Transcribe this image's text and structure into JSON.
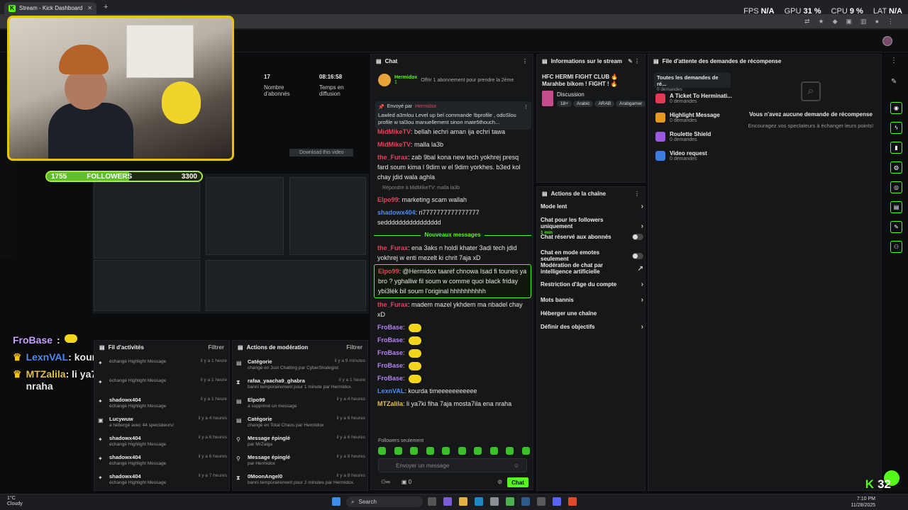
{
  "browser": {
    "tab_title": "Stream - Kick Dashboard",
    "new_tab": "+"
  },
  "perf": {
    "fps_label": "FPS",
    "fps": "N/A",
    "gpu_label": "GPU",
    "gpu": "31 %",
    "cpu_label": "CPU",
    "cpu": "9 %",
    "lat_label": "LAT",
    "lat": "N/A"
  },
  "stream_overlay": {
    "download_label": "Download this video",
    "followers_current": "1755",
    "followers_label": "FOLLOWERS",
    "followers_goal": "3300",
    "followers_progress": 0.53,
    "chat": [
      {
        "user": "FroBase",
        "text": ""
      },
      {
        "user": "LexnVAL",
        "text": "kourda timeeeeeeeeeee"
      },
      {
        "user": "MTZalila",
        "text": "li ya7ki fiha 7aja mosta7ila ena nraha"
      }
    ]
  },
  "stats": {
    "followers_value": "17",
    "followers_label": "Nombre d'abonnés",
    "time_value": "08:16:58",
    "time_label": "Temps en diffusion"
  },
  "chat": {
    "title": "Chat",
    "sub_user": "Hermidox",
    "sub_text": "Offrir 1 abonnement pour prendre la 2ème",
    "sub_count": "1",
    "pinned_label": "Envoyé par",
    "pinned_by": "Hermidox",
    "pinned_text": "Lawled a3mlou Level up bel commande !bprofile , odoSlou profile w tal3ou manuellement sinon mate5thouch...",
    "messages": [
      {
        "user": "MidMikeTV",
        "color": "#e0465a",
        "text": ": bellah iechri aman ija echri tawa"
      },
      {
        "user": "MidMikeTV",
        "color": "#e0465a",
        "text": ": malla la3b"
      },
      {
        "user": "the_Furax",
        "color": "#e0465a",
        "text": ": zab 9bal kona new tech yokhrej presq fard soum kima l 9dim w el 9dim yorkhes. b3ed kol chay jdid wala aghla"
      },
      {
        "reply": "Répondre à MidMikeTV: malla la3b"
      },
      {
        "user": "Elpo99",
        "color": "#e0465a",
        "text": ": marketing scam wallah"
      },
      {
        "user": "shadowx404",
        "color": "#4d8cf5",
        "text": ": ri7777777777777777 sedddddddddddddddd"
      },
      {
        "separator": "Nouveaux messages"
      },
      {
        "user": "the_Furax",
        "color": "#e0465a",
        "text": ": ena 3aks n holdi khater 3adi tech jdid yokhrej w enti mezelt ki chrit 7aja xD"
      },
      {
        "user": "Elpo99",
        "color": "#e0465a",
        "text": ": @Hermidox taaref chnowa Isad fi tounes ya bro ? yghalliw fil soum w comme quoi black friday ybi3lék bil soum l'original hhhhhhhhhh",
        "highlight": true
      },
      {
        "user": "the_Furax",
        "color": "#e0465a",
        "text": ": madem mazel ykhdem ma nbadel chay xD"
      },
      {
        "user": "FroBase",
        "color": "#b782f5",
        "text": ":",
        "emote": true
      },
      {
        "user": "FroBase",
        "color": "#b782f5",
        "text": ":",
        "emote": true
      },
      {
        "user": "FroBase",
        "color": "#b782f5",
        "text": ":",
        "emote": true
      },
      {
        "user": "FroBase",
        "color": "#b782f5",
        "text": ":",
        "emote": true
      },
      {
        "user": "FroBase",
        "color": "#b782f5",
        "text": ":",
        "emote": true
      },
      {
        "user": "LexnVAL",
        "color": "#4d8cf5",
        "text": ": kourda timeeeeeeeeeee"
      },
      {
        "user": "MTZalila",
        "color": "#e7c04b",
        "text": ": li ya7ki fiha 7aja mosta7ila ena nraha"
      }
    ],
    "followers_only": "Followers seulement",
    "input_placeholder": "Envoyer un message",
    "viewer_count": "0",
    "send_label": "Chat"
  },
  "info": {
    "title": "Informations sur le stream",
    "stream_title": "HFC HERMI FIGHT CLUB 🔥 Marahbe bikom ! FIGHT ! 🔥",
    "category": "Discussion",
    "tags": [
      "18+",
      "Arabic",
      "ARAB",
      "Arabgamer"
    ]
  },
  "actions": {
    "title": "Actions de la chaîne",
    "items": [
      {
        "label": "Mode lent",
        "kind": "chev"
      },
      {
        "label": "Chat pour les followers uniquement",
        "sub": "1 min",
        "kind": "chev"
      },
      {
        "label": "Chat réservé aux abonnés",
        "kind": "toggle"
      },
      {
        "label": "Chat en mode emotes seulement",
        "kind": "toggle"
      },
      {
        "label": "Modération de chat par intelligence artificielle",
        "kind": "ext"
      },
      {
        "label": "Restriction d'âge du compte",
        "kind": "chev"
      },
      {
        "label": "Mots bannis",
        "kind": "chev"
      },
      {
        "label": "Héberger une chaîne",
        "kind": "none"
      },
      {
        "label": "Définir des objectifs",
        "kind": "chev"
      }
    ]
  },
  "rewards": {
    "title": "File d'attente des demandes de récompense",
    "filter_label": "Toutes les demandes de ré...",
    "filter_count": "0 demandes",
    "items": [
      {
        "name": "A Ticket To Herminati...",
        "count": "0 demandes",
        "color": "#e03b55"
      },
      {
        "name": "Highlight Message",
        "count": "0 demandes",
        "color": "#e69a1d"
      },
      {
        "name": "Roulette Shield",
        "count": "0 demandes",
        "color": "#9b59e0"
      },
      {
        "name": "Video request",
        "count": "0 demandes",
        "color": "#3b7de0"
      }
    ],
    "empty_title": "Vous n'avez aucune demande de récompense",
    "empty_sub": "Encouragez vos spectateurs à échanger leurs points!"
  },
  "activity": {
    "title": "Fil d'activités",
    "filter": "Filtrer",
    "rows": [
      {
        "user": "",
        "action": "échangé Highlight Message",
        "time": "il y a 1 heure"
      },
      {
        "user": "",
        "action": "échangé Highlight Message",
        "time": "il y a 1 heure"
      },
      {
        "user": "shadowx404",
        "action": "échangé Highlight Message",
        "time": "il y a 1 heure"
      },
      {
        "user": "Lucywuw",
        "action": "a hébergé avec 44 spectateurs!",
        "time": "il y a 4 heures"
      },
      {
        "user": "shadowx404",
        "action": "échangé Highlight Message",
        "time": "il y a 6 heures"
      },
      {
        "user": "shadowx404",
        "action": "échangé Highlight Message",
        "time": "il y a 6 heures"
      },
      {
        "user": "shadowx404",
        "action": "échangé Highlight Message",
        "time": "il y a 7 heures"
      }
    ]
  },
  "modlog": {
    "title": "Actions de modération",
    "filter": "Filtrer",
    "rows": [
      {
        "user": "Catégorie",
        "action": "changé en Just Chatting par CyberStrategist",
        "time": "il y a 9 minutes"
      },
      {
        "user": "rafaa_yaacha9_ghabra",
        "action": "banni temporairement pour 1 minute par Hermidox.",
        "time": "il y a 1 heure"
      },
      {
        "user": "Elpo99",
        "action": "a supprimé un message",
        "time": "il y a 4 heures"
      },
      {
        "user": "Catégorie",
        "action": "changé en Total Chaos par Hermidox",
        "time": "il y a 6 heures"
      },
      {
        "user": "Message épinglé",
        "action": "par MrZaiga",
        "time": "il y a 6 heures"
      },
      {
        "user": "Message épinglé",
        "action": "par Hermidox",
        "time": "il y a 8 heures"
      },
      {
        "user": "0MoonAngel0",
        "action": "banni temporairement pour 2 minutes par Hermidox.",
        "time": "il y a 8 heures"
      }
    ]
  },
  "kick_counter": "32",
  "taskbar": {
    "search": "Search",
    "weather_temp": "1°C",
    "weather_desc": "Cloudy",
    "time": "7:10 PM",
    "date": "11/28/2025"
  }
}
